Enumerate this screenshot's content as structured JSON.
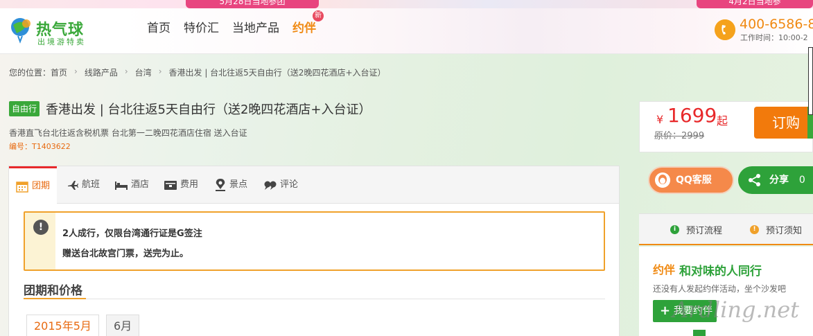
{
  "banner": {
    "left_text": "5月28日当地参团",
    "right_text": "4月2日当地参"
  },
  "header": {
    "logo_main": "热气球",
    "logo_sub": "出境游特卖",
    "nav": [
      "首页",
      "特价汇",
      "当地产品",
      "约伴"
    ],
    "new_badge": "新",
    "phone": "400-6586-8",
    "work_time": "工作时间：10:00-2"
  },
  "breadcrumb": {
    "prefix": "您的位置：",
    "items": [
      "首页",
      "线路产品",
      "台湾",
      "香港出发 | 台北往返5天自由行（送2晚四花酒店+入台证）"
    ]
  },
  "product": {
    "tag": "自由行",
    "title": "香港出发 | 台北往返5天自由行（送2晚四花酒店+入台证）",
    "desc": "香港直飞台北往返含税机票 台北第一二晚四花酒店住宿 送入台证",
    "code": "编号：T1403622"
  },
  "price": {
    "currency": "¥",
    "value": "1699",
    "suffix": "起",
    "original": "原价：2999",
    "order_label": "订购"
  },
  "tabs": [
    {
      "label": "团期",
      "icon": "calendar-icon"
    },
    {
      "label": "航班",
      "icon": "plane-icon"
    },
    {
      "label": "酒店",
      "icon": "bed-icon"
    },
    {
      "label": "费用",
      "icon": "wallet-icon"
    },
    {
      "label": "景点",
      "icon": "location-icon"
    },
    {
      "label": "评论",
      "icon": "comment-icon"
    }
  ],
  "notice": {
    "line1": "2人成行，仅限台湾通行证是G签注",
    "line2": "赠送台北故宫门票，送完为止。"
  },
  "schedule": {
    "title": "团期和价格",
    "months": [
      "2015年5月",
      "6月"
    ]
  },
  "sidebar": {
    "qq_label": "QQ客服",
    "share_label": "分享",
    "share_count": "0",
    "booking_flow": "预订流程",
    "booking_notes": "预订须知",
    "companion_logo": "约伴",
    "companion_title": "和对味的人同行",
    "companion_desc": "还没有人发起约伴活动，坐个沙发吧",
    "companion_btn": "我要约伴"
  },
  "watermark": "Ardling.net",
  "colors": {
    "brand_green": "#3aa83a",
    "accent_orange": "#f27a0c",
    "price_red": "#e8292b"
  }
}
